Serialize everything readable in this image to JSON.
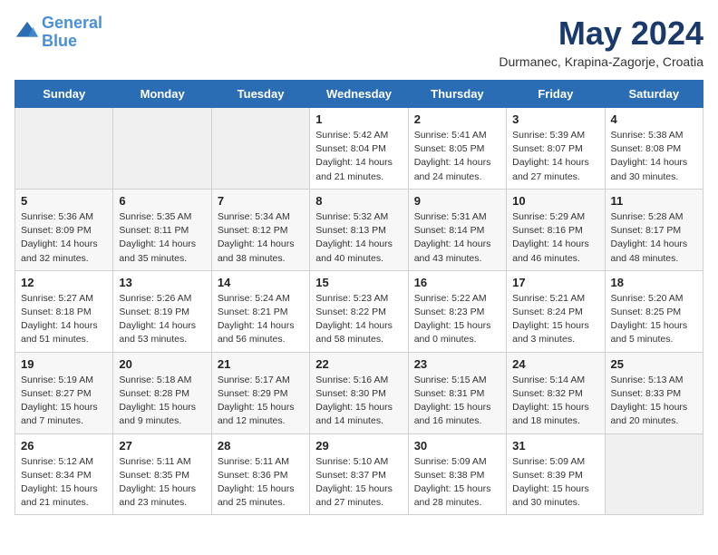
{
  "header": {
    "logo_line1": "General",
    "logo_line2": "Blue",
    "month_title": "May 2024",
    "subtitle": "Durmanec, Krapina-Zagorje, Croatia"
  },
  "days_of_week": [
    "Sunday",
    "Monday",
    "Tuesday",
    "Wednesday",
    "Thursday",
    "Friday",
    "Saturday"
  ],
  "weeks": [
    [
      {
        "day": "",
        "info": ""
      },
      {
        "day": "",
        "info": ""
      },
      {
        "day": "",
        "info": ""
      },
      {
        "day": "1",
        "info": "Sunrise: 5:42 AM\nSunset: 8:04 PM\nDaylight: 14 hours\nand 21 minutes."
      },
      {
        "day": "2",
        "info": "Sunrise: 5:41 AM\nSunset: 8:05 PM\nDaylight: 14 hours\nand 24 minutes."
      },
      {
        "day": "3",
        "info": "Sunrise: 5:39 AM\nSunset: 8:07 PM\nDaylight: 14 hours\nand 27 minutes."
      },
      {
        "day": "4",
        "info": "Sunrise: 5:38 AM\nSunset: 8:08 PM\nDaylight: 14 hours\nand 30 minutes."
      }
    ],
    [
      {
        "day": "5",
        "info": "Sunrise: 5:36 AM\nSunset: 8:09 PM\nDaylight: 14 hours\nand 32 minutes."
      },
      {
        "day": "6",
        "info": "Sunrise: 5:35 AM\nSunset: 8:11 PM\nDaylight: 14 hours\nand 35 minutes."
      },
      {
        "day": "7",
        "info": "Sunrise: 5:34 AM\nSunset: 8:12 PM\nDaylight: 14 hours\nand 38 minutes."
      },
      {
        "day": "8",
        "info": "Sunrise: 5:32 AM\nSunset: 8:13 PM\nDaylight: 14 hours\nand 40 minutes."
      },
      {
        "day": "9",
        "info": "Sunrise: 5:31 AM\nSunset: 8:14 PM\nDaylight: 14 hours\nand 43 minutes."
      },
      {
        "day": "10",
        "info": "Sunrise: 5:29 AM\nSunset: 8:16 PM\nDaylight: 14 hours\nand 46 minutes."
      },
      {
        "day": "11",
        "info": "Sunrise: 5:28 AM\nSunset: 8:17 PM\nDaylight: 14 hours\nand 48 minutes."
      }
    ],
    [
      {
        "day": "12",
        "info": "Sunrise: 5:27 AM\nSunset: 8:18 PM\nDaylight: 14 hours\nand 51 minutes."
      },
      {
        "day": "13",
        "info": "Sunrise: 5:26 AM\nSunset: 8:19 PM\nDaylight: 14 hours\nand 53 minutes."
      },
      {
        "day": "14",
        "info": "Sunrise: 5:24 AM\nSunset: 8:21 PM\nDaylight: 14 hours\nand 56 minutes."
      },
      {
        "day": "15",
        "info": "Sunrise: 5:23 AM\nSunset: 8:22 PM\nDaylight: 14 hours\nand 58 minutes."
      },
      {
        "day": "16",
        "info": "Sunrise: 5:22 AM\nSunset: 8:23 PM\nDaylight: 15 hours\nand 0 minutes."
      },
      {
        "day": "17",
        "info": "Sunrise: 5:21 AM\nSunset: 8:24 PM\nDaylight: 15 hours\nand 3 minutes."
      },
      {
        "day": "18",
        "info": "Sunrise: 5:20 AM\nSunset: 8:25 PM\nDaylight: 15 hours\nand 5 minutes."
      }
    ],
    [
      {
        "day": "19",
        "info": "Sunrise: 5:19 AM\nSunset: 8:27 PM\nDaylight: 15 hours\nand 7 minutes."
      },
      {
        "day": "20",
        "info": "Sunrise: 5:18 AM\nSunset: 8:28 PM\nDaylight: 15 hours\nand 9 minutes."
      },
      {
        "day": "21",
        "info": "Sunrise: 5:17 AM\nSunset: 8:29 PM\nDaylight: 15 hours\nand 12 minutes."
      },
      {
        "day": "22",
        "info": "Sunrise: 5:16 AM\nSunset: 8:30 PM\nDaylight: 15 hours\nand 14 minutes."
      },
      {
        "day": "23",
        "info": "Sunrise: 5:15 AM\nSunset: 8:31 PM\nDaylight: 15 hours\nand 16 minutes."
      },
      {
        "day": "24",
        "info": "Sunrise: 5:14 AM\nSunset: 8:32 PM\nDaylight: 15 hours\nand 18 minutes."
      },
      {
        "day": "25",
        "info": "Sunrise: 5:13 AM\nSunset: 8:33 PM\nDaylight: 15 hours\nand 20 minutes."
      }
    ],
    [
      {
        "day": "26",
        "info": "Sunrise: 5:12 AM\nSunset: 8:34 PM\nDaylight: 15 hours\nand 21 minutes."
      },
      {
        "day": "27",
        "info": "Sunrise: 5:11 AM\nSunset: 8:35 PM\nDaylight: 15 hours\nand 23 minutes."
      },
      {
        "day": "28",
        "info": "Sunrise: 5:11 AM\nSunset: 8:36 PM\nDaylight: 15 hours\nand 25 minutes."
      },
      {
        "day": "29",
        "info": "Sunrise: 5:10 AM\nSunset: 8:37 PM\nDaylight: 15 hours\nand 27 minutes."
      },
      {
        "day": "30",
        "info": "Sunrise: 5:09 AM\nSunset: 8:38 PM\nDaylight: 15 hours\nand 28 minutes."
      },
      {
        "day": "31",
        "info": "Sunrise: 5:09 AM\nSunset: 8:39 PM\nDaylight: 15 hours\nand 30 minutes."
      },
      {
        "day": "",
        "info": ""
      }
    ]
  ]
}
